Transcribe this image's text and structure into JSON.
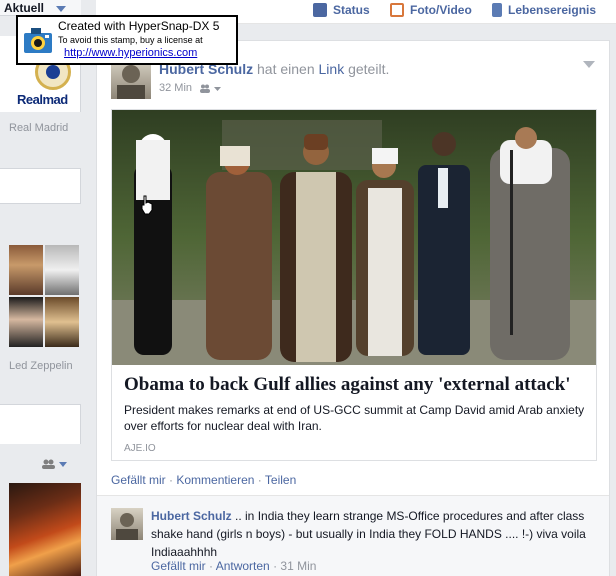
{
  "left": {
    "aktuell_label": "Aktuell",
    "brand_wordmark": "Realmad",
    "page1_name": "Real Madrid",
    "page2_name": "Led Zeppelin"
  },
  "topbar": {
    "status_label": "Status",
    "foto_label": "Foto/Video",
    "event_label": "Lebensereignis"
  },
  "stamp": {
    "line1": "Created with HyperSnap-DX 5",
    "line2": "To avoid this stamp, buy a license at",
    "line3": "http://www.hyperionics.com"
  },
  "post": {
    "author": "Hubert Schulz",
    "verb_before": "hat einen",
    "link_word": "Link",
    "verb_after": "geteilt.",
    "time": "32 Min",
    "share": {
      "title": "Obama to back Gulf allies against any 'external attack'",
      "description": "President makes remarks at end of US-GCC summit at Camp David amid Arab anxiety over efforts for nuclear deal with Iran.",
      "source": "AJE.IO"
    },
    "actions": {
      "like": "Gefällt mir",
      "comment": "Kommentieren",
      "share": "Teilen",
      "separator": "·"
    },
    "comment": {
      "author": "Hubert Schulz",
      "text": ".. in India they learn strange MS-Office procedures and after class shake hand (girls n boys) - but usually in India they FOLD HANDS .... !-) viva voila Indiaaahhhh",
      "like": "Gefällt mir",
      "reply": "Antworten",
      "time": "31 Min"
    }
  },
  "colors": {
    "link_blue": "#4b67a1",
    "meta_gray": "#90949c",
    "page_bg": "#e9ebee"
  },
  "icons": [
    "status-pencil-icon",
    "photo-icon",
    "life-event-flag-icon",
    "audience-friends-icon",
    "chevron-down-icon",
    "camera-icon",
    "mouse-cursor-icon"
  ]
}
